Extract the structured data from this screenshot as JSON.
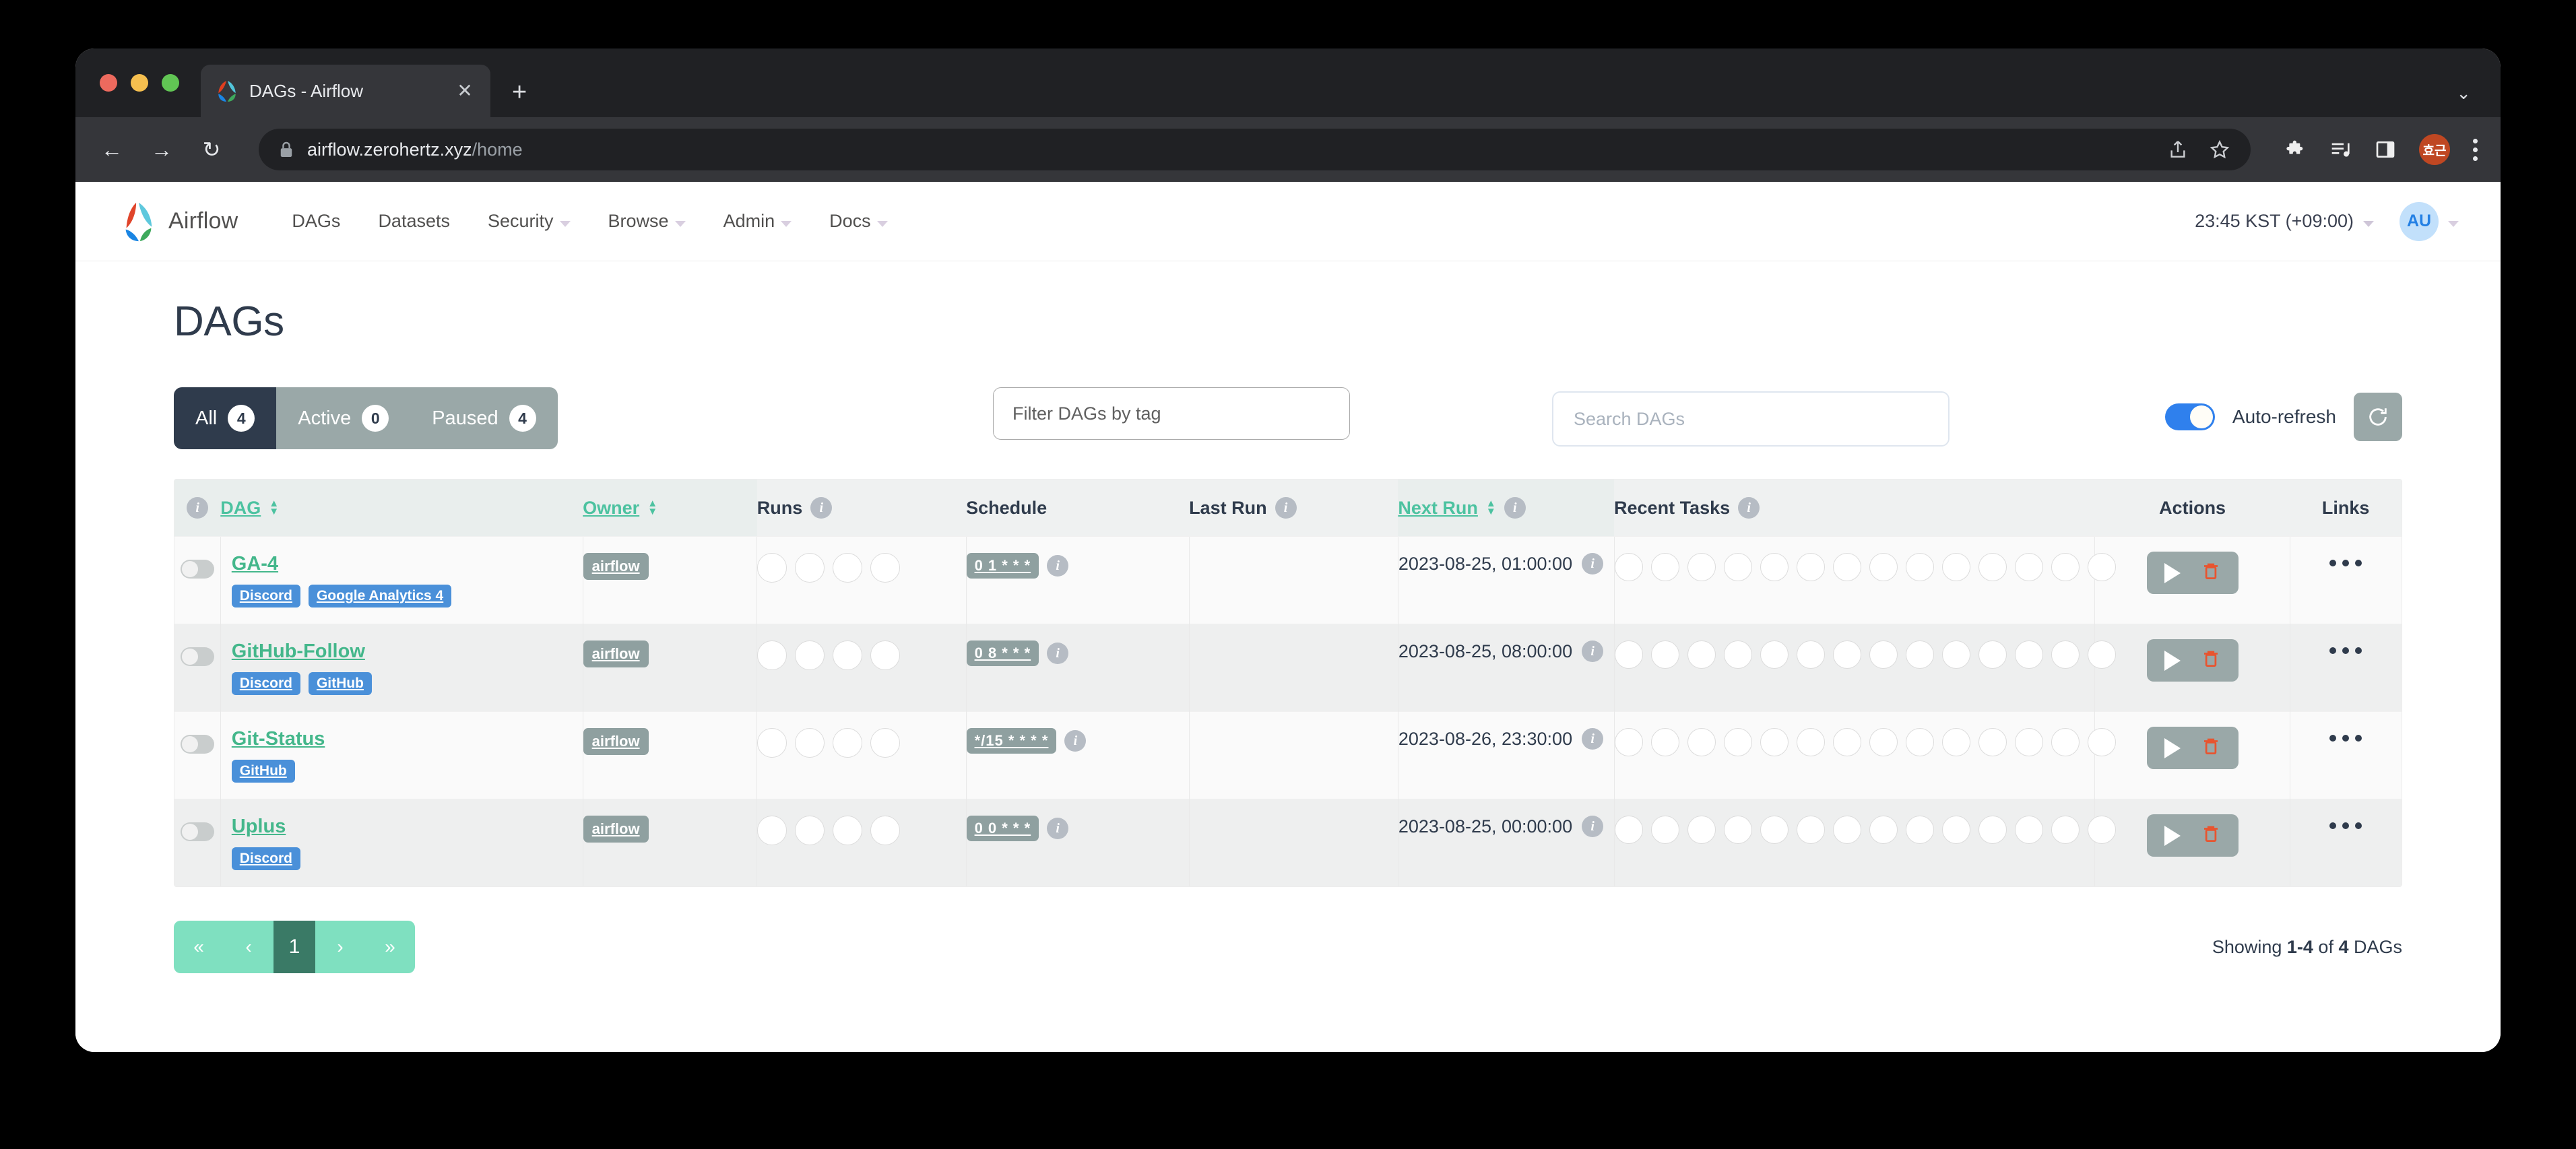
{
  "browser": {
    "tab": {
      "title": "DAGs - Airflow",
      "favicon": "airflow-pinwheel-icon",
      "close": "✕"
    },
    "new_tab": "+",
    "tabstrip_chevron": "⌄",
    "nav": {
      "back": "←",
      "forward": "→",
      "reload": "↻"
    },
    "url": {
      "domain": "airflow.zerohertz.xyz",
      "path": "/home",
      "lock": "lock-icon"
    },
    "profile_initials": "효근"
  },
  "navbar": {
    "brand": "Airflow",
    "links": [
      {
        "label": "DAGs",
        "has_caret": false
      },
      {
        "label": "Datasets",
        "has_caret": false
      },
      {
        "label": "Security",
        "has_caret": true
      },
      {
        "label": "Browse",
        "has_caret": true
      },
      {
        "label": "Admin",
        "has_caret": true
      },
      {
        "label": "Docs",
        "has_caret": true
      }
    ],
    "timezone": "23:45 KST (+09:00)",
    "avatar_initials": "AU"
  },
  "page": {
    "title": "DAGs"
  },
  "filters": {
    "tabs": [
      {
        "label": "All",
        "count": "4",
        "active": true
      },
      {
        "label": "Active",
        "count": "0",
        "active": false
      },
      {
        "label": "Paused",
        "count": "4",
        "active": false
      }
    ],
    "tag_filter_placeholder": "Filter DAGs by tag",
    "search_placeholder": "Search DAGs",
    "auto_refresh_label": "Auto-refresh",
    "auto_refresh_on": true,
    "refresh_icon": "refresh-icon"
  },
  "table": {
    "columns": [
      {
        "key": "info",
        "label": "",
        "info": true
      },
      {
        "key": "dag",
        "label": "DAG",
        "sortable": true
      },
      {
        "key": "owner",
        "label": "Owner",
        "sortable": true
      },
      {
        "key": "runs",
        "label": "Runs",
        "info": true
      },
      {
        "key": "schedule",
        "label": "Schedule"
      },
      {
        "key": "last_run",
        "label": "Last Run",
        "info": true
      },
      {
        "key": "next_run",
        "label": "Next Run",
        "sortable": true,
        "info": true
      },
      {
        "key": "recent_tasks",
        "label": "Recent Tasks",
        "info": true
      },
      {
        "key": "actions",
        "label": "Actions"
      },
      {
        "key": "links",
        "label": "Links"
      }
    ],
    "runs_circle_count": 4,
    "recent_tasks_circle_count": 14,
    "rows": [
      {
        "name": "GA-4",
        "paused": true,
        "tags": [
          "Discord",
          "Google Analytics 4"
        ],
        "owner": "airflow",
        "schedule": "0 1 * * *",
        "last_run": "",
        "next_run": "2023-08-25, 01:00:00"
      },
      {
        "name": "GitHub-Follow",
        "paused": true,
        "tags": [
          "Discord",
          "GitHub"
        ],
        "owner": "airflow",
        "schedule": "0 8 * * *",
        "last_run": "",
        "next_run": "2023-08-25, 08:00:00"
      },
      {
        "name": "Git-Status",
        "paused": true,
        "tags": [
          "GitHub"
        ],
        "owner": "airflow",
        "schedule": "*/15 * * * *",
        "last_run": "",
        "next_run": "2023-08-26, 23:30:00"
      },
      {
        "name": "Uplus",
        "paused": true,
        "tags": [
          "Discord"
        ],
        "owner": "airflow",
        "schedule": "0 0 * * *",
        "last_run": "",
        "next_run": "2023-08-25, 00:00:00"
      }
    ]
  },
  "pagination": {
    "first": "«",
    "prev": "‹",
    "current": "1",
    "next": "›",
    "last": "»",
    "showing_prefix": "Showing ",
    "showing_range": "1-4",
    "showing_mid": " of ",
    "showing_total": "4",
    "showing_suffix": " DAGs"
  },
  "colors": {
    "accent_green": "#44b78b",
    "tag_blue": "#4a90d9",
    "dark_navy": "#2f3b4c",
    "muted_gray": "#9aa8a8",
    "delete_red": "#e8542f",
    "toggle_blue": "#2f80ed",
    "pager_green": "#7fe0c0"
  }
}
